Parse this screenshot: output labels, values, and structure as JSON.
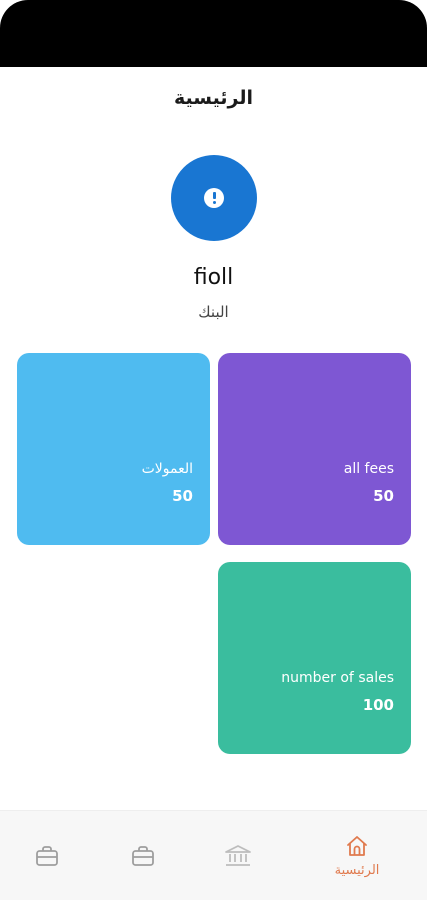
{
  "header": {
    "title": "الرئيسية"
  },
  "profile": {
    "name": "fioll",
    "subtitle": "البنك",
    "avatar_icon": "exclamation-icon"
  },
  "cards": [
    {
      "label": "all fees",
      "value": "50",
      "color": "#7e57d3"
    },
    {
      "label": "العمولات",
      "value": "50",
      "color": "#4fbbf0"
    },
    {
      "label": "number of sales",
      "value": "100",
      "color": "#3abd9e"
    }
  ],
  "bottom_nav": {
    "items": [
      {
        "icon": "briefcase-icon",
        "label": ""
      },
      {
        "icon": "briefcase-icon",
        "label": ""
      },
      {
        "icon": "bank-icon",
        "label": ""
      },
      {
        "icon": "home-icon",
        "label": "الرئيسية",
        "active": true
      }
    ],
    "active_color": "#e07a4e",
    "inactive_color": "#9e9e9e"
  }
}
